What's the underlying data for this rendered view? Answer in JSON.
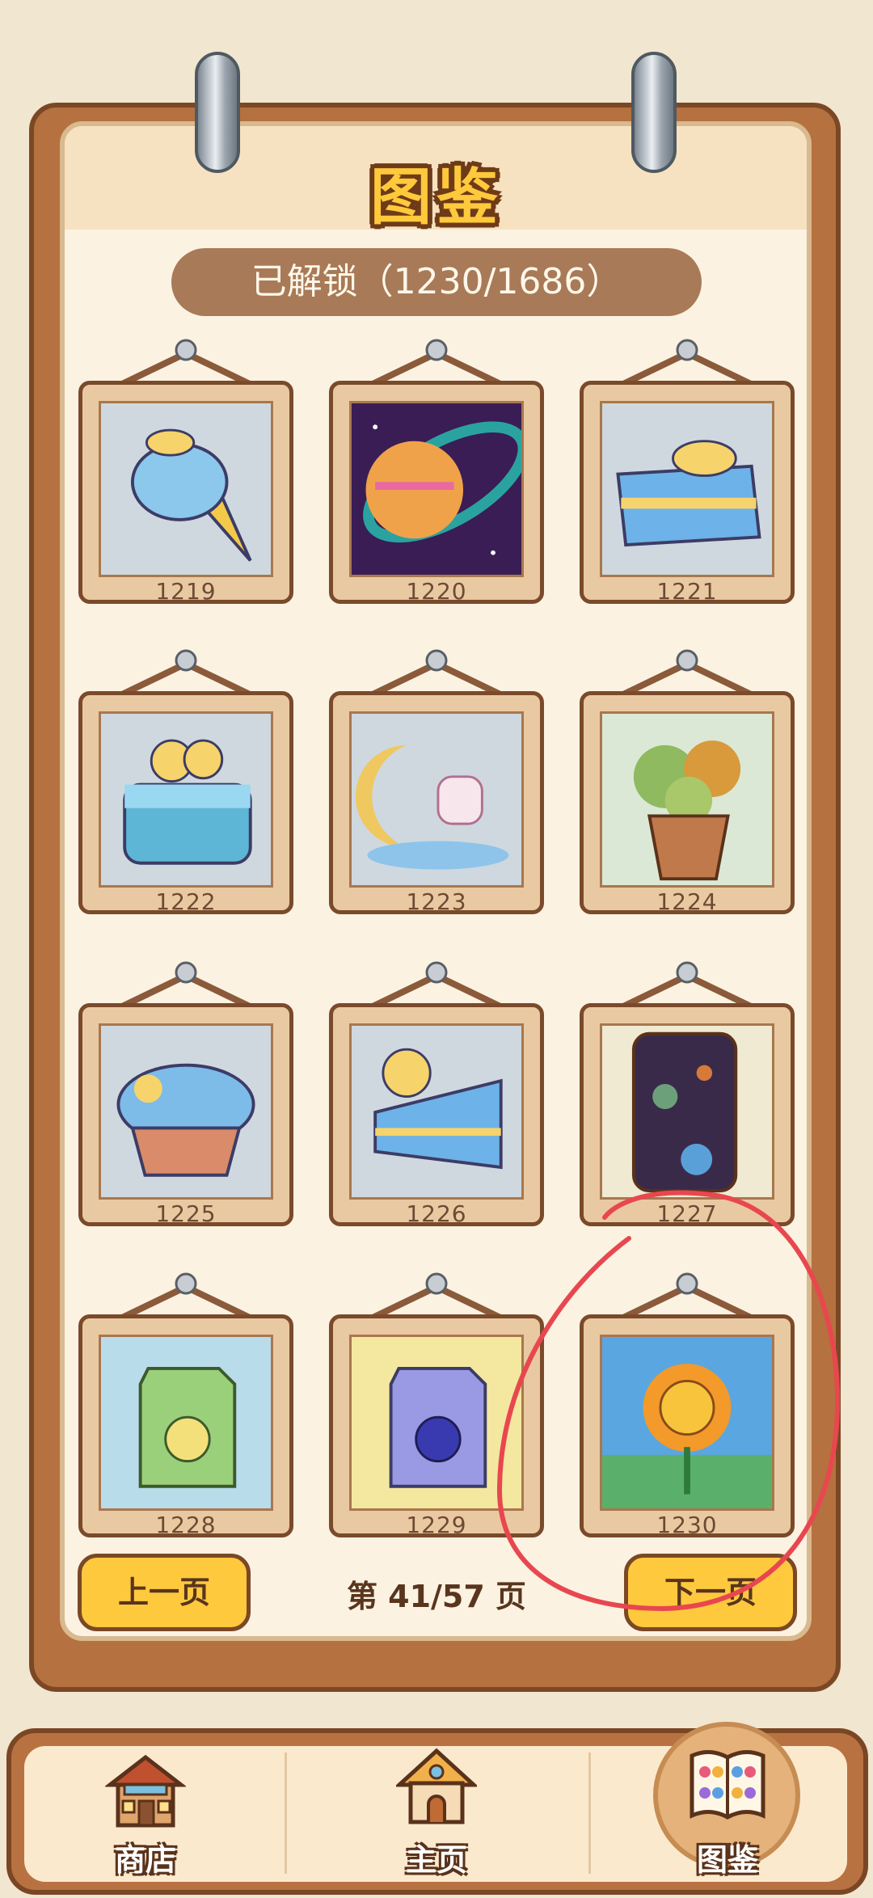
{
  "header": {
    "title": "图鉴",
    "unlock_status": "已解锁（1230/1686）"
  },
  "gallery": {
    "items": [
      {
        "number": "1219",
        "art": "blue-ice-cream-cone"
      },
      {
        "number": "1220",
        "art": "planet-in-space"
      },
      {
        "number": "1221",
        "art": "blue-cake-slice"
      },
      {
        "number": "1222",
        "art": "blue-layer-cake"
      },
      {
        "number": "1223",
        "art": "bunny-on-moon"
      },
      {
        "number": "1224",
        "art": "potted-plant"
      },
      {
        "number": "1225",
        "art": "blue-cupcake"
      },
      {
        "number": "1226",
        "art": "blue-cake-wedge"
      },
      {
        "number": "1227",
        "art": "space-bottle"
      },
      {
        "number": "1228",
        "art": "apple-juice-box"
      },
      {
        "number": "1229",
        "art": "blueberry-juice-box"
      },
      {
        "number": "1230",
        "art": "sunflower"
      }
    ]
  },
  "pagination": {
    "prev_label": "上一页",
    "next_label": "下一页",
    "page_label": "第 41/57 页"
  },
  "tabbar": {
    "tabs": [
      {
        "label": "商店",
        "icon": "shop-house-icon"
      },
      {
        "label": "主页",
        "icon": "home-cottage-icon"
      },
      {
        "label": "图鉴",
        "icon": "flower-book-icon",
        "active": true
      }
    ]
  },
  "annotation": {
    "shape": "red-hand-drawn-circle",
    "color": "#e8474f",
    "target": "1230"
  }
}
